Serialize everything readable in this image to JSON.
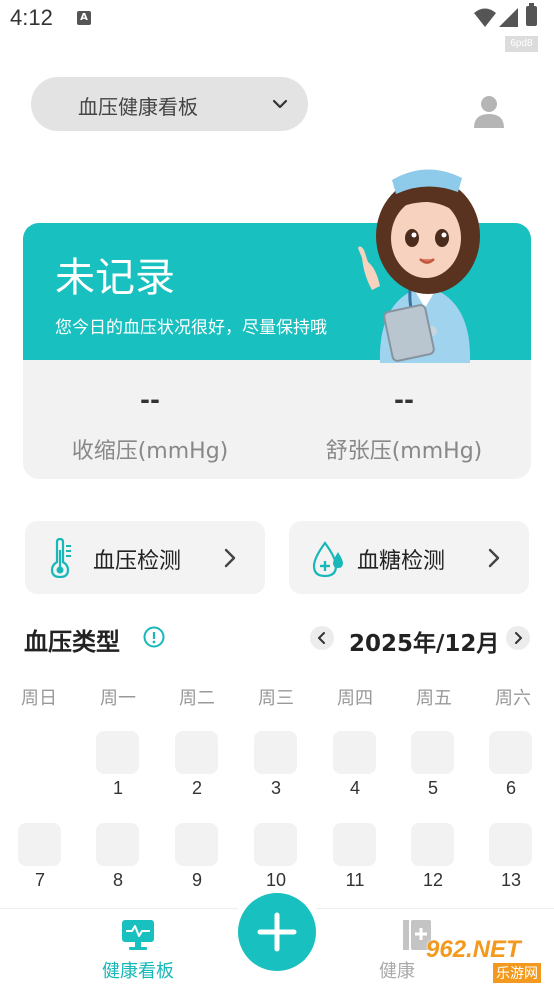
{
  "status_bar": {
    "time": "4:12",
    "notification_letter": "A",
    "tag": "6pd8"
  },
  "header": {
    "board_selector_label": "血压健康看板"
  },
  "status_card": {
    "title": "未记录",
    "description": "您今日的血压状况很好，尽量保持哦",
    "systolic_value": "--",
    "systolic_label": "收缩压(mmHg)",
    "diastolic_value": "--",
    "diastolic_label": "舒张压(mmHg)",
    "accent_color": "#18c0c0"
  },
  "detect": {
    "bp_label": "血压检测",
    "glucose_label": "血糖检测"
  },
  "calendar": {
    "title": "血压类型",
    "month": "2025年/12月",
    "weekdays": [
      "周日",
      "周一",
      "周二",
      "周三",
      "周四",
      "周五",
      "周六"
    ],
    "days": [
      "1",
      "2",
      "3",
      "4",
      "5",
      "6",
      "7",
      "8",
      "9",
      "10",
      "11",
      "12",
      "13"
    ]
  },
  "bottom_nav": {
    "dashboard_label": "健康看板",
    "second_label": "健康"
  },
  "watermark": {
    "text": "962.NET",
    "sub": "乐游网"
  }
}
